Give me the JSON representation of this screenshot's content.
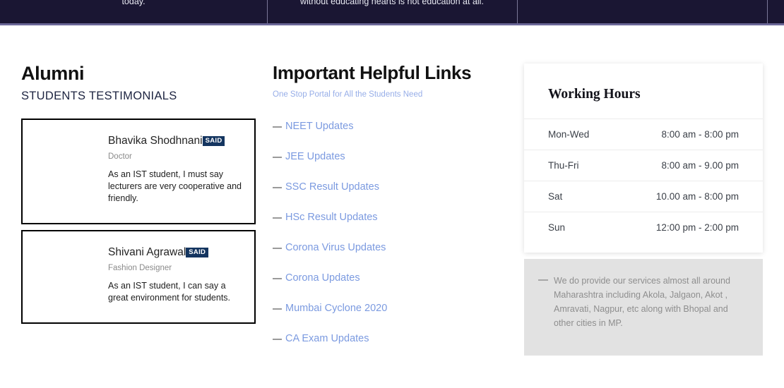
{
  "topbar": {
    "column1_text": "today.",
    "column2_text": "without educating hearts is not education at all.",
    "column3_text": "",
    "column4_text": ""
  },
  "alumni": {
    "title": "Alumni",
    "subtitle": "STUDENTS TESTIMONIALS",
    "badge_label": "SAID",
    "testimonials": [
      {
        "name": "Bhavika Shodhnani",
        "badge": "SAID",
        "role": "Doctor",
        "quote": "As an IST student, I must say lecturers are very cooperative and friendly."
      },
      {
        "name": "Shivani Agrawal",
        "badge": "SAID",
        "role": "Fashion Designer",
        "quote": "As an IST student, I can say a great environment for  students."
      }
    ]
  },
  "links_section": {
    "title": "Important Helpful Links",
    "subtitle": "One Stop Portal for All the Students Need",
    "links": [
      {
        "label": "NEET Updates"
      },
      {
        "label": "JEE Updates"
      },
      {
        "label": "SSC Result Updates"
      },
      {
        "label": "HSc Result Updates"
      },
      {
        "label": "Corona Virus Updates"
      },
      {
        "label": "Corona Updates"
      },
      {
        "label": "Mumbai Cyclone 2020"
      },
      {
        "label": "CA Exam Updates"
      }
    ]
  },
  "working_hours": {
    "title": "Working Hours",
    "rows": [
      {
        "day": "Mon-Wed",
        "time": "8:00 am - 8:00 pm"
      },
      {
        "day": "Thu-Fri",
        "time": "8:00 am - 9.00 pm"
      },
      {
        "day": "Sat",
        "time": "10.00 am - 8:00 pm"
      },
      {
        "day": "Sun",
        "time": "12:00 pm - 2:00 pm"
      }
    ],
    "notice": "We do provide our services almost all around Maharashtra including Akola, Jalgaon, Akot , Amravati, Nagpur, etc along with  Bhopal  and other cities in MP."
  },
  "colors": {
    "topbar_navy": "#1a1633",
    "topbar_rule": "#6b6898",
    "link_blue": "#7b9ae0",
    "subtitle_blue": "#97aee8",
    "badge_navy": "#143560",
    "notice_bg": "#e2e2e2"
  }
}
